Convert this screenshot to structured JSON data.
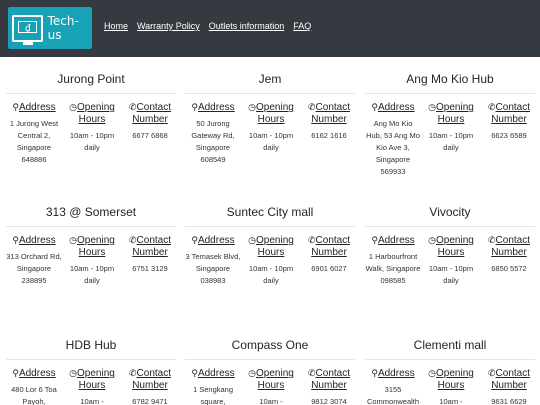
{
  "brand": {
    "name": "Tech-us"
  },
  "nav": {
    "links": [
      "Home",
      "Warranty Policy",
      "Outlets information",
      "FAQ"
    ]
  },
  "labels": {
    "address": "Address",
    "opening_hours": "Opening Hours",
    "contact_number": "Contact Number"
  },
  "icons": {
    "address": "map-marker-icon",
    "hours": "clock-icon",
    "contact": "phone-icon"
  },
  "outlets": [
    {
      "name": "Jurong Point",
      "address": "1 Jurong West Central 2, Singapore 648886",
      "hours": "10am - 10pm daily",
      "phone": "6677 6868"
    },
    {
      "name": "Jem",
      "address": "50 Jurong Gateway Rd, Singapore 608549",
      "hours": "10am - 10pm daily",
      "phone": "6162 1616"
    },
    {
      "name": "Ang Mo Kio Hub",
      "address": "Ang Mo Kio Hub, 53 Ang Mo Kio Ave 3, Singapore 569933",
      "hours": "10am - 10pm daily",
      "phone": "6623 6589"
    },
    {
      "name": "313 @ Somerset",
      "address": "313 Orchard Rd, Singapore 238895",
      "hours": "10am - 10pm daily",
      "phone": "6751 3129"
    },
    {
      "name": "Suntec City mall",
      "address": "3 Temasek Blvd, Singapore 038983",
      "hours": "10am - 10pm daily",
      "phone": "6901 6027"
    },
    {
      "name": "Vivocity",
      "address": "1 Harbourfront Walk, Singapore 098585",
      "hours": "10am - 10pm daily",
      "phone": "6850 5572"
    },
    {
      "name": "HDB Hub",
      "address": "480 Lor 6 Toa Payoh,",
      "hours": "10am -",
      "phone": "6782 9471"
    },
    {
      "name": "Compass One",
      "address": "1 Sengkang square,",
      "hours": "10am -",
      "phone": "9812 3074"
    },
    {
      "name": "Clementi mall",
      "address": "3155 Commonwealth",
      "hours": "10am -",
      "phone": "9631 6629"
    }
  ]
}
